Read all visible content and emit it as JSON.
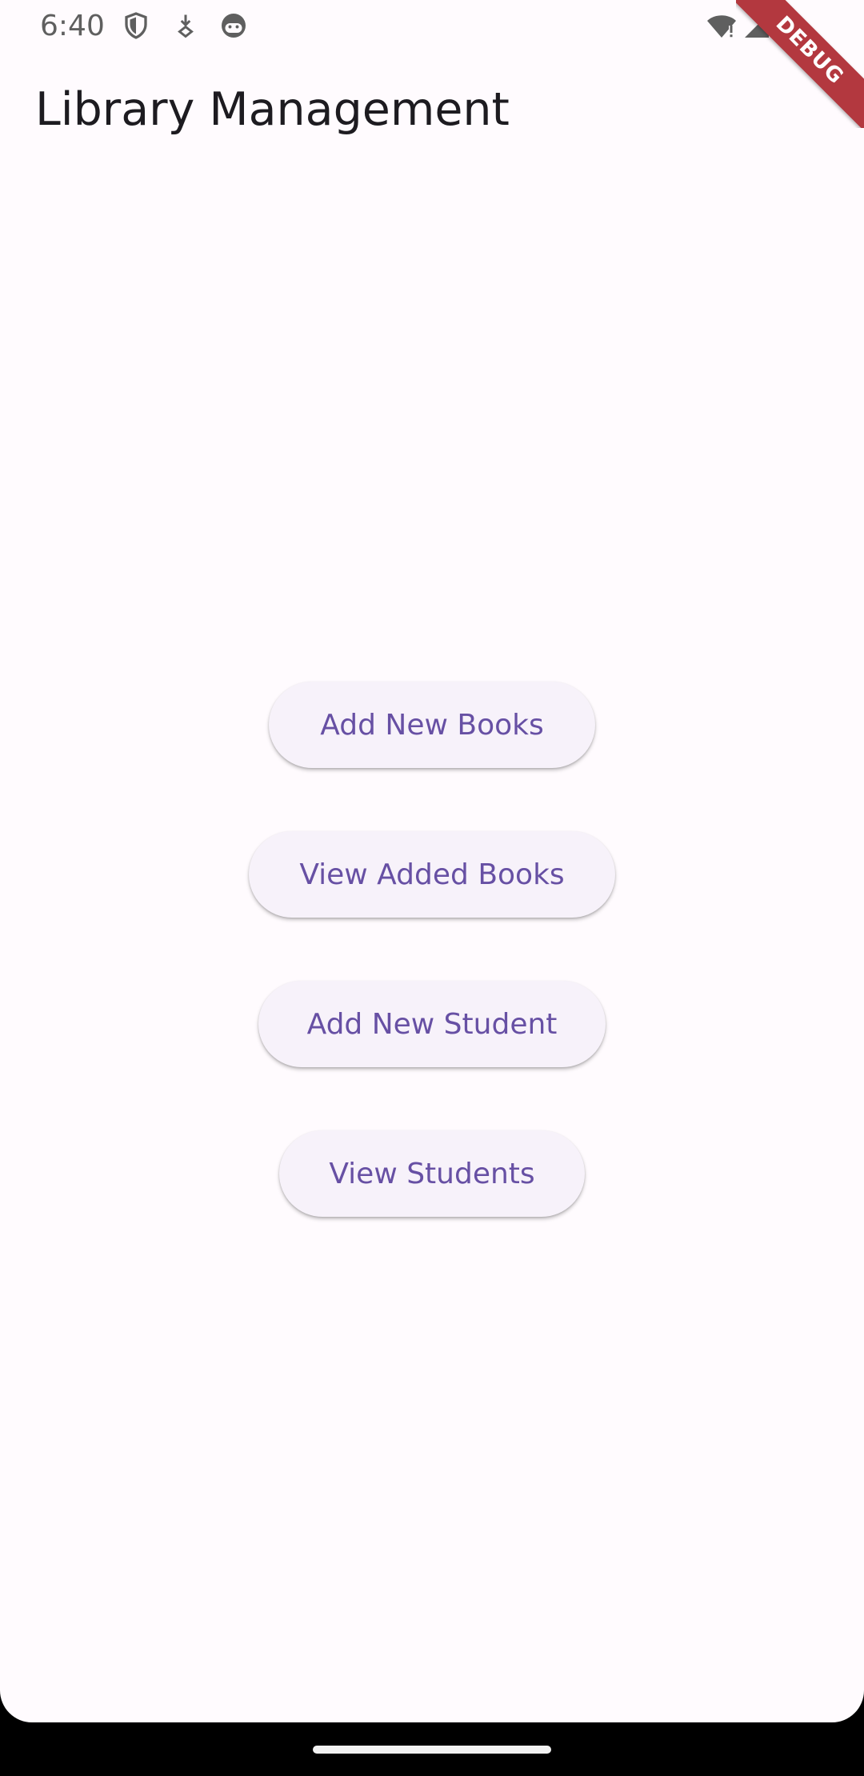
{
  "status_bar": {
    "time": "6:40",
    "left_icons": [
      "shield-icon",
      "download-icon",
      "face-icon"
    ],
    "right_icons": [
      "wifi-alert-icon",
      "cellular-signal-icon",
      "battery-icon"
    ]
  },
  "app_bar": {
    "title": "Library Management"
  },
  "debug_banner": {
    "label": "DEBUG",
    "color": "#b3383f"
  },
  "menu": {
    "buttons": [
      {
        "label": "Add New Books"
      },
      {
        "label": "View Added Books"
      },
      {
        "label": "Add New Student"
      },
      {
        "label": "View Students"
      }
    ]
  },
  "theme": {
    "background": "#fffbfe",
    "button_background": "#f7f2fa",
    "button_text": "#6750a4",
    "title_text": "#1d1b20"
  }
}
